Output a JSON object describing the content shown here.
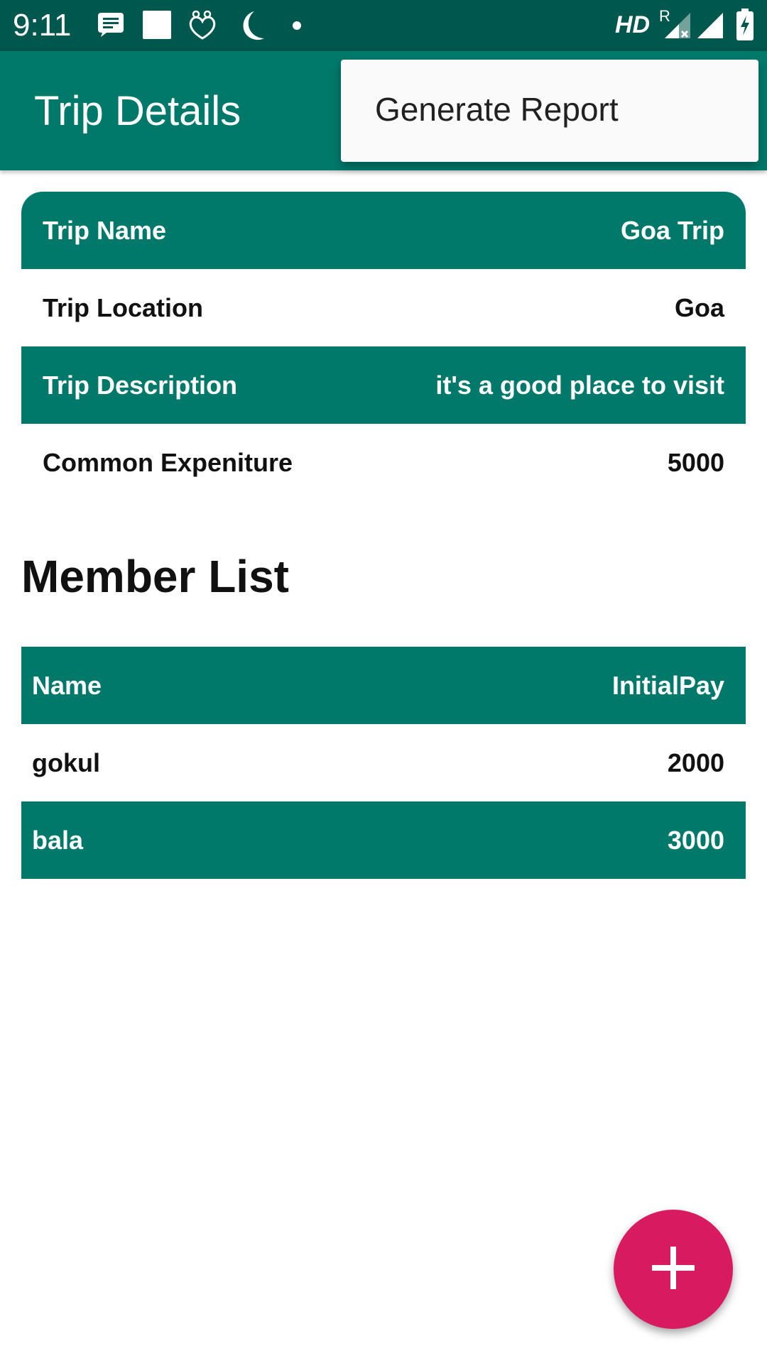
{
  "status_bar": {
    "time": "9:11",
    "network_label": "HD",
    "roaming_label": "R",
    "icons": [
      "message-icon",
      "square-notification-icon",
      "hands-heart-icon",
      "moon-icon",
      "dot-icon",
      "signal-icon",
      "wifi-signal-icon",
      "battery-charging-icon"
    ]
  },
  "app_bar": {
    "title": "Trip Details"
  },
  "overflow_menu": {
    "items": [
      {
        "label": "Generate Report"
      }
    ]
  },
  "trip_details": {
    "rows": [
      {
        "label": "Trip Name",
        "value": "Goa Trip"
      },
      {
        "label": "Trip Location",
        "value": "Goa"
      },
      {
        "label": "Trip Description",
        "value": "it's a good place to visit"
      },
      {
        "label": "Common Expeniture",
        "value": "5000"
      }
    ]
  },
  "member_list": {
    "title": "Member List",
    "header": {
      "name": "Name",
      "pay": "InitialPay"
    },
    "members": [
      {
        "name": "gokul",
        "pay": "2000"
      },
      {
        "name": "bala",
        "pay": "3000"
      }
    ]
  },
  "fab": {
    "icon": "plus-icon"
  },
  "colors": {
    "primary": "#00796b",
    "primary_dark": "#00574e",
    "accent": "#d81b60"
  }
}
